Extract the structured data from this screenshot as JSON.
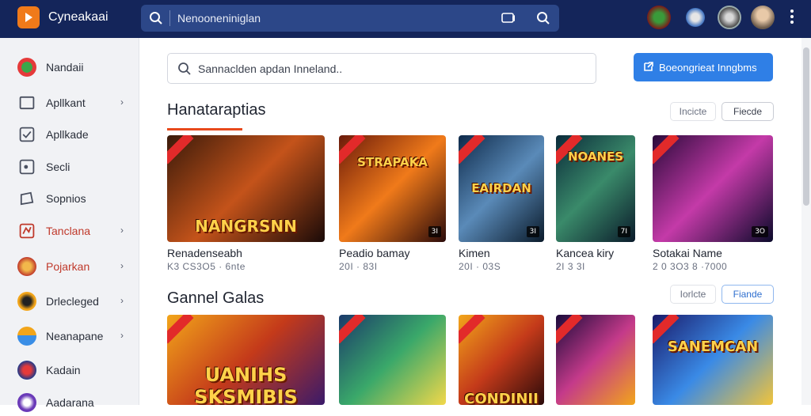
{
  "app": {
    "title": "Cyneakaai"
  },
  "top_search": {
    "text": "Nenooneniniglan"
  },
  "sidebar": {
    "items": [
      {
        "label": "Nandaii",
        "chevron": "",
        "color": "#2a2f3a"
      },
      {
        "label": "Apllkant",
        "chevron": "›",
        "color": "#2a2f3a"
      },
      {
        "label": "Apllkade",
        "chevron": "",
        "color": "#2a2f3a"
      },
      {
        "label": "Secli",
        "chevron": "",
        "color": "#2a2f3a"
      },
      {
        "label": "Sopnios",
        "chevron": "",
        "color": "#2a2f3a"
      },
      {
        "label": "Tanclana",
        "chevron": "›",
        "color": "#c0392b"
      },
      {
        "label": "Pojarkan",
        "chevron": "›",
        "color": "#c0392b"
      },
      {
        "label": "Drlecleged",
        "chevron": "›",
        "color": "#2a2f3a"
      },
      {
        "label": "Neanapane",
        "chevron": "›",
        "color": "#2a2f3a"
      },
      {
        "label": "Kadain",
        "chevron": "",
        "color": "#2a2f3a"
      },
      {
        "label": "Aadarana",
        "chevron": "",
        "color": "#2a2f3a"
      }
    ]
  },
  "main_search": {
    "placeholder": "Sannaclden apdan Inneland.."
  },
  "cta": {
    "label": "Boeongrieat Inngbms"
  },
  "sections": [
    {
      "title": "Hanataraptias",
      "pill_a": "Incicte",
      "pill_b": "Fiecde",
      "cards": [
        {
          "name": "Renadenseabh",
          "meta": "K3 CS3O5 · 6nte",
          "art": "NANGRSNN",
          "badge": ""
        },
        {
          "name": "Peadio bamay",
          "meta": "20I · 83I",
          "art": "STRAPAKA",
          "badge": "3I"
        },
        {
          "name": "Kimen",
          "meta": "20I · 03S",
          "art": "EAIRDAN",
          "badge": "3I"
        },
        {
          "name": "Kancea kiry",
          "meta": "2I 3 3I",
          "art": "NOANES",
          "badge": "7I"
        },
        {
          "name": "Sotakai Name",
          "meta": "2 0 3O3 8 ·7000",
          "art": "",
          "badge": "3O"
        }
      ]
    },
    {
      "title": "Gannel Galas",
      "pill_a": "Iorlcte",
      "pill_b": "Fiande",
      "cards": [
        {
          "name": "",
          "meta": "",
          "art": "UANIHS SKSMIBIS",
          "badge": ""
        },
        {
          "name": "",
          "meta": "",
          "art": "",
          "badge": ""
        },
        {
          "name": "",
          "meta": "",
          "art": "CONDINII",
          "badge": ""
        },
        {
          "name": "",
          "meta": "",
          "art": "",
          "badge": ""
        },
        {
          "name": "",
          "meta": "",
          "art": "SANEMCAN",
          "badge": ""
        }
      ]
    }
  ],
  "colors": {
    "topbar": "#14255a",
    "accent": "#2f7fe6",
    "underline": "#e8491c",
    "ribbon": "#e22a2a"
  }
}
